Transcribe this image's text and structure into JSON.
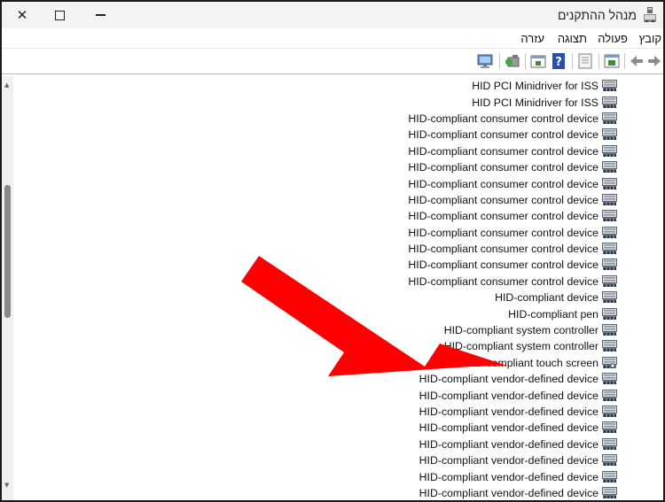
{
  "window": {
    "title": "מנהל ההתקנים",
    "close_symbol": "✕"
  },
  "menu": {
    "items": [
      "קובץ",
      "פעולה",
      "תצוגה",
      "עזרה"
    ]
  },
  "toolbar": {
    "buttons": [
      "back-arrow-icon",
      "forward-arrow-icon",
      "properties-icon",
      "help-icon",
      "show-hidden-icon",
      "update-driver-icon",
      "scan-hardware-icon",
      "computer-icon"
    ]
  },
  "devices": [
    "HID PCI Minidriver for ISS",
    "HID PCI Minidriver for ISS",
    "HID-compliant consumer control device",
    "HID-compliant consumer control device",
    "HID-compliant consumer control device",
    "HID-compliant consumer control device",
    "HID-compliant consumer control device",
    "HID-compliant consumer control device",
    "HID-compliant consumer control device",
    "HID-compliant consumer control device",
    "HID-compliant consumer control device",
    "HID-compliant consumer control device",
    "HID-compliant consumer control device",
    "HID-compliant device",
    "HID-compliant pen",
    "HID-compliant system controller",
    "HID-compliant system controller",
    "HID-compliant touch screen",
    "HID-compliant vendor-defined device",
    "HID-compliant vendor-defined device",
    "HID-compliant vendor-defined device",
    "HID-compliant vendor-defined device",
    "HID-compliant vendor-defined device",
    "HID-compliant vendor-defined device",
    "HID-compliant vendor-defined device",
    "HID-compliant vendor-defined device"
  ],
  "colors": {
    "annotation_arrow": "#ff0000"
  }
}
